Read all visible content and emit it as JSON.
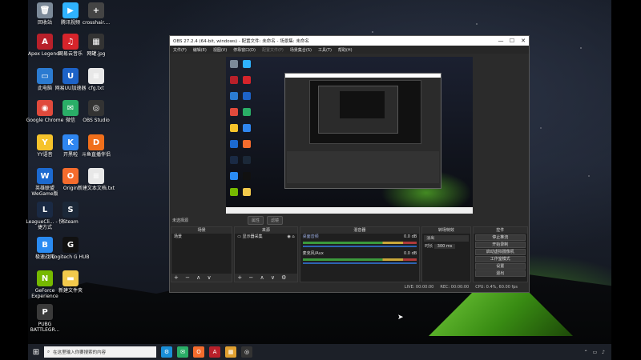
{
  "desktop": {
    "icons": [
      {
        "label": "回收站",
        "color": "#7c8a99",
        "glyph": "🗑"
      },
      {
        "label": "腾讯视频",
        "color": "#2fb3ff",
        "glyph": "▶"
      },
      {
        "label": "crosshair....",
        "color": "#444444",
        "glyph": "+"
      },
      {
        "label": "Apex Legends",
        "color": "#b8202a",
        "glyph": "A"
      },
      {
        "label": "网易云音乐",
        "color": "#d6242b",
        "glyph": "♫"
      },
      {
        "label": "网罐.jpg",
        "color": "#333333",
        "glyph": "▦"
      },
      {
        "label": "此电脑",
        "color": "#2b7bd1",
        "glyph": "▭"
      },
      {
        "label": "网易UU加速器",
        "color": "#1d63c8",
        "glyph": "U"
      },
      {
        "label": "cfg.txt",
        "color": "#e8e8e8",
        "glyph": "≡"
      },
      {
        "label": "Google Chrome",
        "color": "#e04a3c",
        "glyph": "◉"
      },
      {
        "label": "微信",
        "color": "#2aae67",
        "glyph": "✉"
      },
      {
        "label": "OBS Studio",
        "color": "#333333",
        "glyph": "◎"
      },
      {
        "label": "YY语音",
        "color": "#f6c32b",
        "glyph": "Y"
      },
      {
        "label": "开黑啦",
        "color": "#2f86f0",
        "glyph": "K"
      },
      {
        "label": "斗鱼直播伴侣",
        "color": "#f06f1b",
        "glyph": "D"
      },
      {
        "label": "英雄联盟 WeGame版",
        "color": "#1c6ad0",
        "glyph": "W"
      },
      {
        "label": "Origin",
        "color": "#f56c2d",
        "glyph": "O"
      },
      {
        "label": "新建文本文档.txt",
        "color": "#e8e8e8",
        "glyph": "≡"
      },
      {
        "label": "LeagueCli... - 快捷方式",
        "color": "#1a2a44",
        "glyph": "L"
      },
      {
        "label": "Steam",
        "color": "#1b2838",
        "glyph": "S"
      },
      {
        "label": "极速战网",
        "color": "#2a8bf2",
        "glyph": "B"
      },
      {
        "label": "Logitech G HUB",
        "color": "#111111",
        "glyph": "G"
      },
      {
        "label": "GeForce Experience",
        "color": "#76b900",
        "glyph": "N"
      },
      {
        "label": "新建文件夹",
        "color": "#f2c94c",
        "glyph": "▬"
      },
      {
        "label": "PUBG BATTLEGR...",
        "color": "#3a3a3a",
        "glyph": "P"
      }
    ]
  },
  "obs": {
    "title": "OBS 27.2.4 (64-bit, windows) - 配置文件: 未命名 - 场景集: 未命名",
    "window_buttons": [
      "—",
      "☐",
      "✕"
    ],
    "menu": [
      "文件(F)",
      "编辑(E)",
      "视图(V)",
      "停靠窗口(D)",
      "配置文件(P)",
      "场景集合(S)",
      "工具(T)",
      "帮助(H)"
    ],
    "source_bar": {
      "label": "未选择源",
      "properties": "属性",
      "filters": "滤镜"
    },
    "docks": {
      "scenes": {
        "title": "场景",
        "items": [
          "场景"
        ]
      },
      "sources": {
        "title": "来源",
        "items": [
          "显示器采集"
        ]
      },
      "mixer": {
        "title": "混音器",
        "channels": [
          {
            "name": "桌面音频",
            "db": "0.0 dB"
          },
          {
            "name": "麦克风/Aux",
            "db": "0.0 dB"
          }
        ]
      },
      "transitions": {
        "title": "转场特效",
        "type": "淡出",
        "duration_label": "时长",
        "duration": "300 ms"
      },
      "controls": {
        "title": "控件",
        "buttons": [
          "停止推流",
          "开始录制",
          "启动虚拟摄像机",
          "工作室模式",
          "设置",
          "退出"
        ]
      }
    },
    "status": {
      "live": "LIVE: 00:00:00",
      "rec": "REC: 00:00:00",
      "cpu": "CPU: 0.4%, 60.00 fps"
    },
    "dock_tools": "+ − ∧ ∨"
  },
  "taskbar": {
    "search_placeholder": "在这里输入你要搜索的内容",
    "apps": [
      {
        "name": "settings",
        "color": "#1a8fd8",
        "glyph": "⚙"
      },
      {
        "name": "wechat",
        "color": "#2aae67",
        "glyph": "✉"
      },
      {
        "name": "origin",
        "color": "#f56c2d",
        "glyph": "O"
      },
      {
        "name": "apex",
        "color": "#b8202a",
        "glyph": "A"
      },
      {
        "name": "gallery",
        "color": "#e0a030",
        "glyph": "▦"
      },
      {
        "name": "obs",
        "color": "#333333",
        "glyph": "◎"
      }
    ],
    "tray": "⌃ ▭ ♪"
  }
}
